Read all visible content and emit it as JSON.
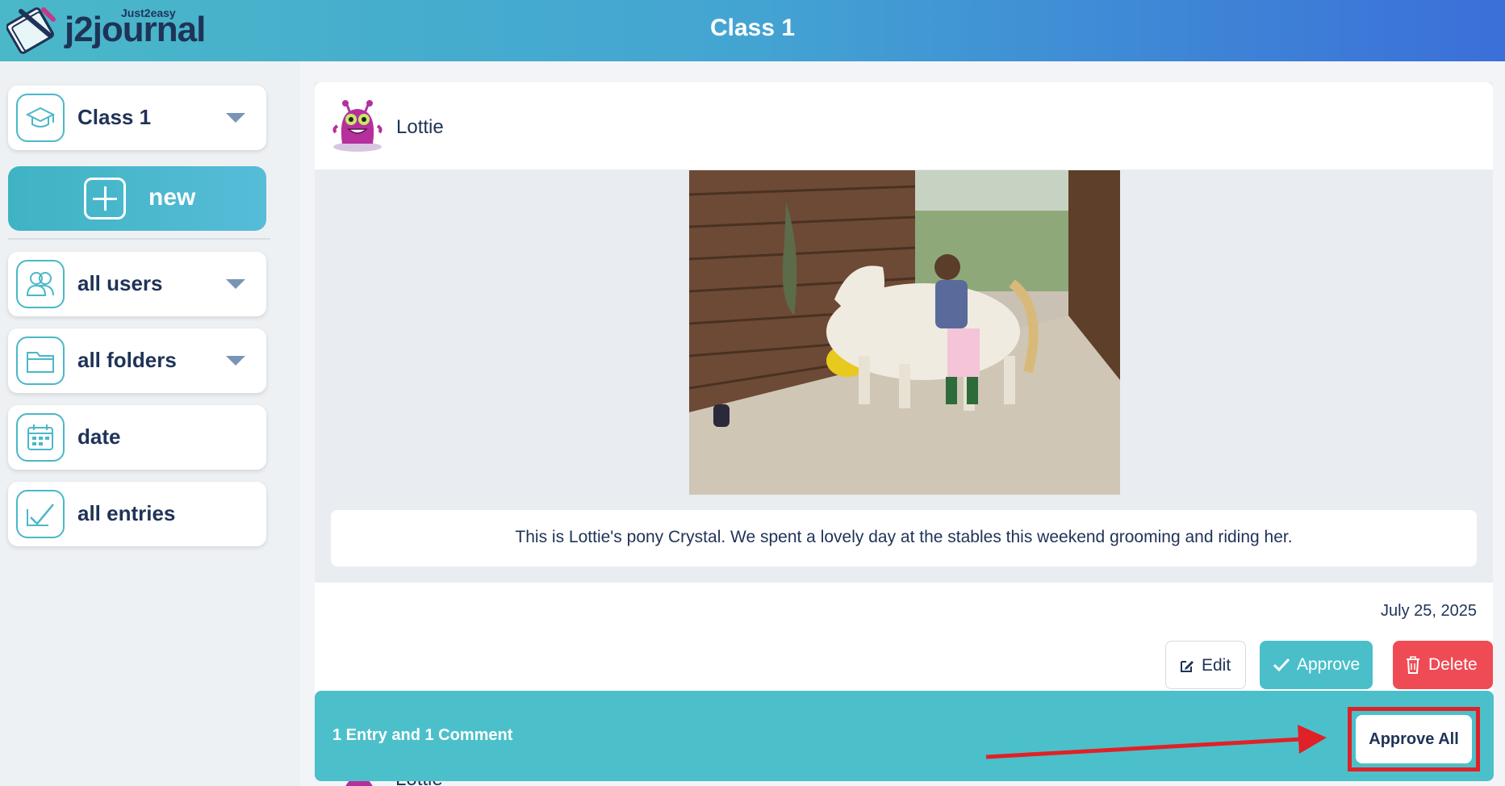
{
  "app": {
    "brand_small": "Just2easy",
    "brand": "j2journal",
    "title": "Class 1"
  },
  "sidebar": {
    "class_selector": {
      "label": "Class 1",
      "icon": "graduation-cap-icon"
    },
    "new_button": {
      "label": "new",
      "icon": "plus-icon"
    },
    "items": [
      {
        "label": "all users",
        "icon": "users-icon",
        "has_dropdown": true
      },
      {
        "label": "all folders",
        "icon": "folder-icon",
        "has_dropdown": true
      },
      {
        "label": "date",
        "icon": "calendar-icon",
        "has_dropdown": false
      },
      {
        "label": "all entries",
        "icon": "checkmark-icon",
        "has_dropdown": false
      }
    ]
  },
  "entry": {
    "author": "Lottie",
    "caption": "This is Lottie's pony Crystal. We spent a lovely day at the stables this weekend grooming and riding her.",
    "date": "July 25, 2025",
    "actions": {
      "edit": "Edit",
      "approve": "Approve",
      "delete": "Delete"
    }
  },
  "next_entry": {
    "author": "Lottie"
  },
  "approval_bar": {
    "summary": "1 Entry and 1 Comment",
    "approve_all": "Approve All"
  },
  "colors": {
    "header_start": "#4ab8c8",
    "header_end": "#3b6fd9",
    "accent": "#4bbfc9",
    "danger": "#ef4b54",
    "text": "#1f3357",
    "annotation": "#e02127"
  }
}
